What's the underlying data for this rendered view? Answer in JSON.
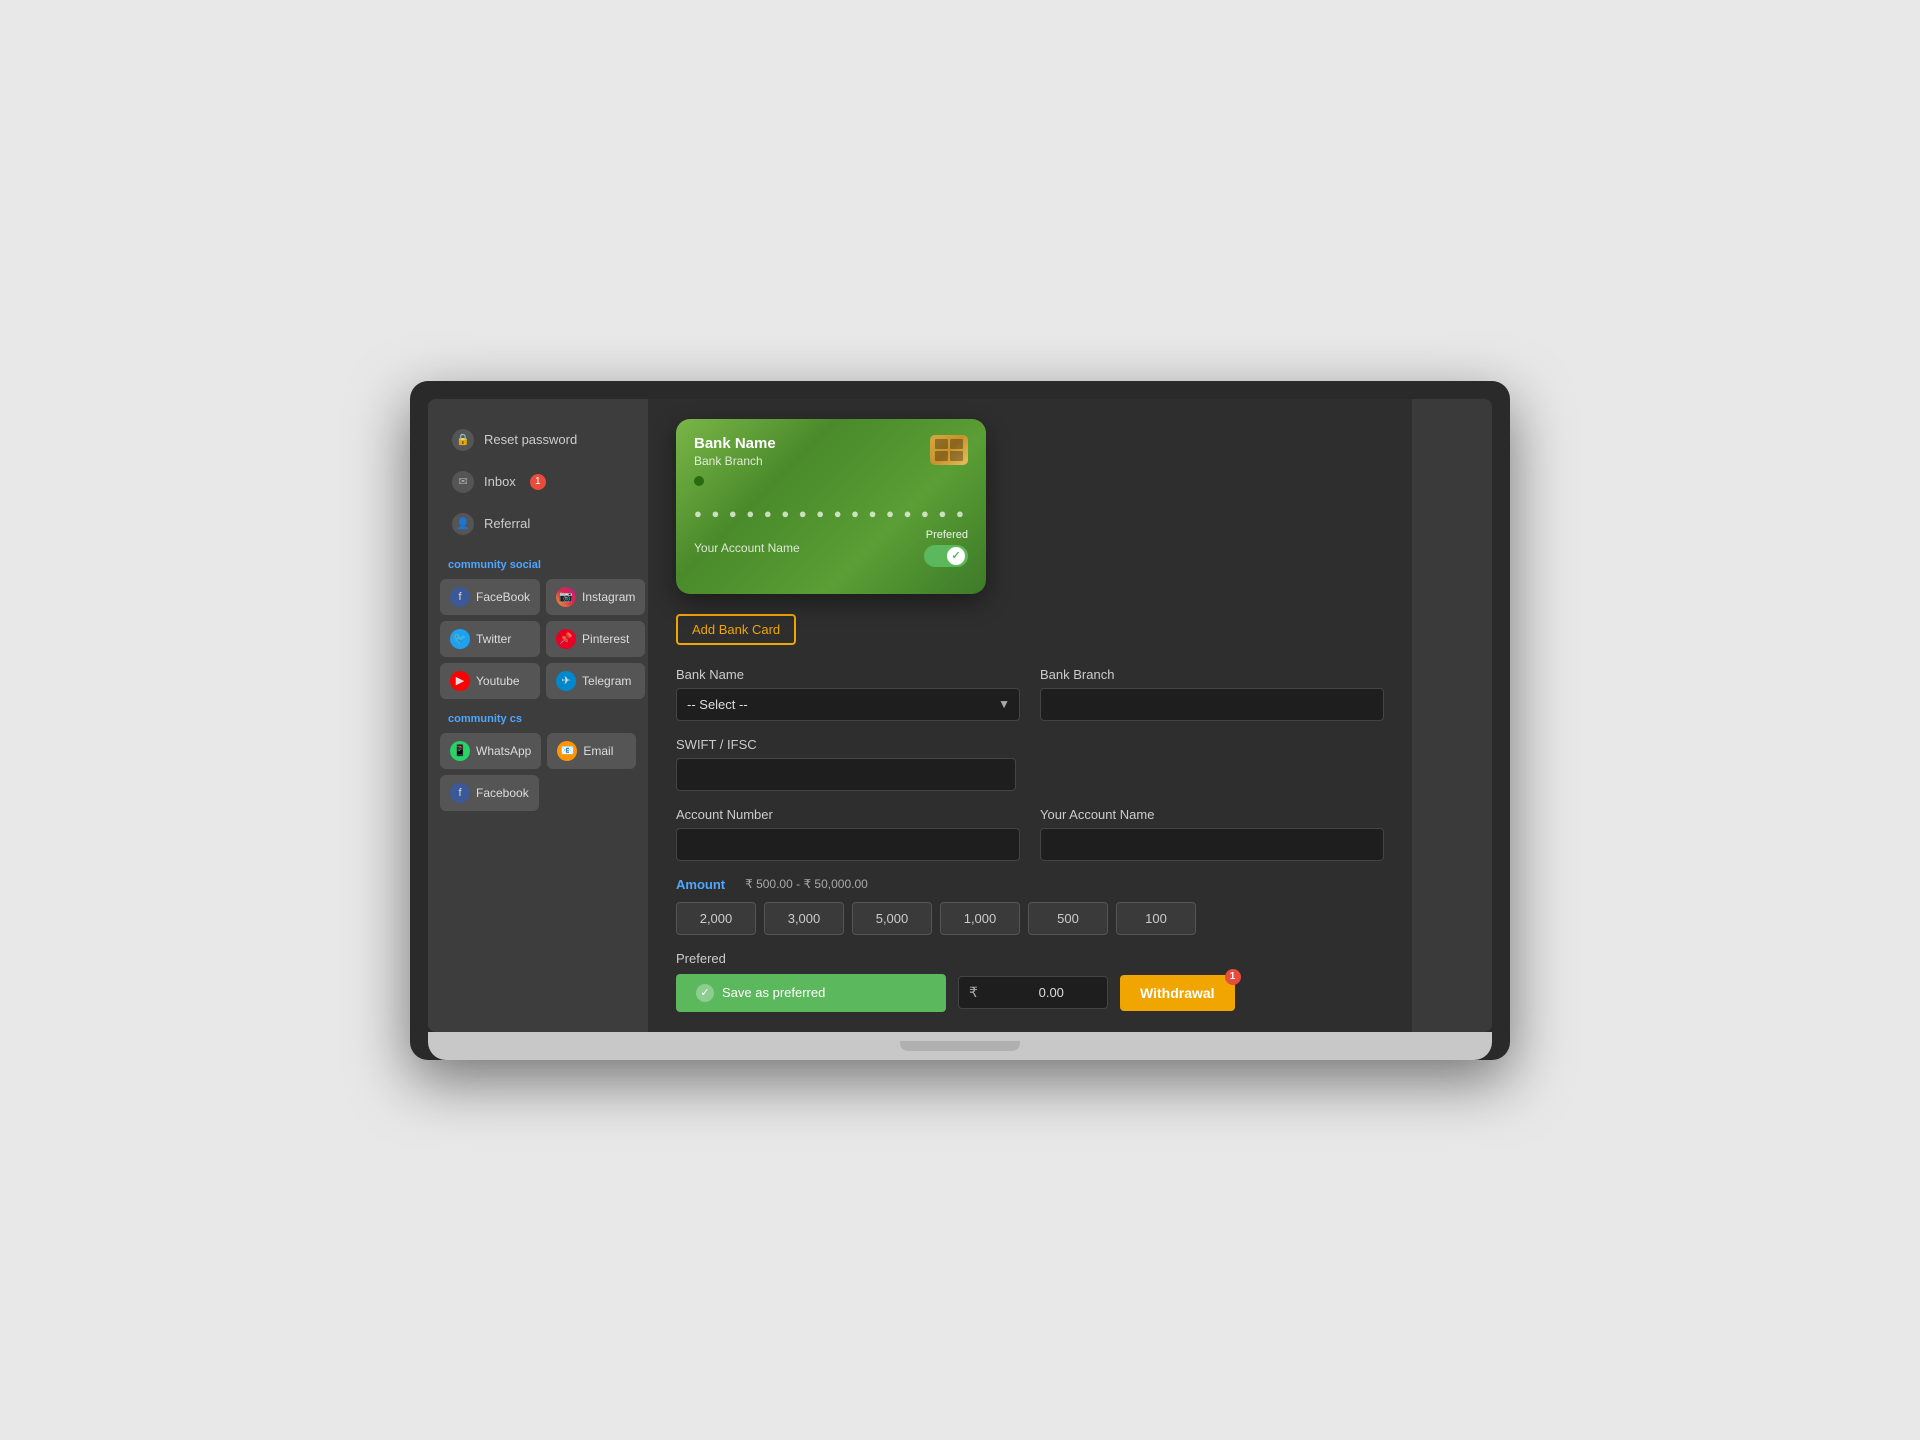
{
  "sidebar": {
    "menu": [
      {
        "id": "reset-password",
        "label": "Reset password",
        "icon": "🔒"
      },
      {
        "id": "inbox",
        "label": "Inbox",
        "icon": "✉️",
        "badge": "1"
      },
      {
        "id": "referral",
        "label": "Referral",
        "icon": "👤"
      }
    ],
    "community_social_label": "community social",
    "social_items": [
      {
        "id": "facebook",
        "label": "FaceBook",
        "icon": "f",
        "icon_class": "icon-fb"
      },
      {
        "id": "instagram",
        "label": "Instagram",
        "icon": "📷",
        "icon_class": "icon-ig"
      },
      {
        "id": "twitter",
        "label": "Twitter",
        "icon": "🐦",
        "icon_class": "icon-tw"
      },
      {
        "id": "pinterest",
        "label": "Pinterest",
        "icon": "📌",
        "icon_class": "icon-pt"
      },
      {
        "id": "youtube",
        "label": "Youtube",
        "icon": "▶",
        "icon_class": "icon-yt"
      },
      {
        "id": "telegram",
        "label": "Telegram",
        "icon": "✈",
        "icon_class": "icon-tg"
      }
    ],
    "community_cs_label": "community cs",
    "cs_items": [
      {
        "id": "whatsapp",
        "label": "WhatsApp",
        "icon": "📱",
        "icon_class": "icon-wa"
      },
      {
        "id": "email",
        "label": "Email",
        "icon": "📧",
        "icon_class": "icon-em"
      },
      {
        "id": "facebook-cs",
        "label": "Facebook",
        "icon": "f",
        "icon_class": "icon-fc"
      }
    ]
  },
  "card": {
    "bank_name": "Bank Name",
    "bank_branch": "Bank Branch",
    "card_number": "● ● ● ●  ● ● ● ●  ● ● ● ●  ● ● ● ●",
    "account_name": "Your Account Name",
    "preferred_label": "Prefered"
  },
  "form": {
    "add_bank_label": "Add Bank Card",
    "bank_name_label": "Bank Name",
    "bank_name_placeholder": "-- Select --",
    "bank_branch_label": "Bank Branch",
    "swift_ifsc_label": "SWIFT / IFSC",
    "account_number_label": "Account Number",
    "your_account_name_label": "Your Account Name",
    "amount_label": "Amount",
    "amount_range": "₹ 500.00 - ₹ 50,000.00",
    "amount_buttons": [
      "2,000",
      "3,000",
      "5,000",
      "1,000",
      "500",
      "100"
    ],
    "preferred_section_label": "Prefered",
    "save_preferred_label": "Save as preferred",
    "amount_currency": "₹",
    "amount_value": "0.00",
    "withdrawal_label": "Withdrawal",
    "withdrawal_badge": "1"
  }
}
